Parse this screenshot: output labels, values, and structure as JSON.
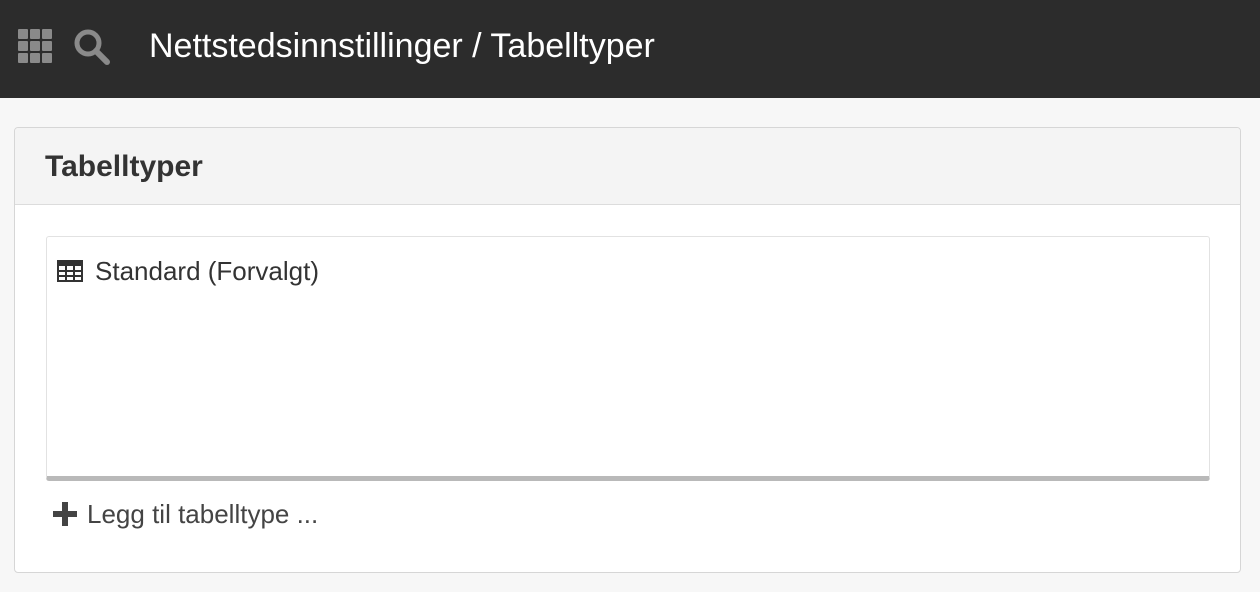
{
  "header": {
    "title": "Nettstedsinnstillinger / Tabelltyper",
    "background": "#2c2c2c",
    "icons": [
      "apps-grid-icon",
      "search-icon"
    ]
  },
  "panel": {
    "title": "Tabelltyper",
    "items": [
      {
        "label": "Standard (Forvalgt)",
        "icon": "table-icon"
      }
    ],
    "add_link": {
      "label": "Legg til tabelltype ...",
      "icon": "plus-icon"
    }
  }
}
